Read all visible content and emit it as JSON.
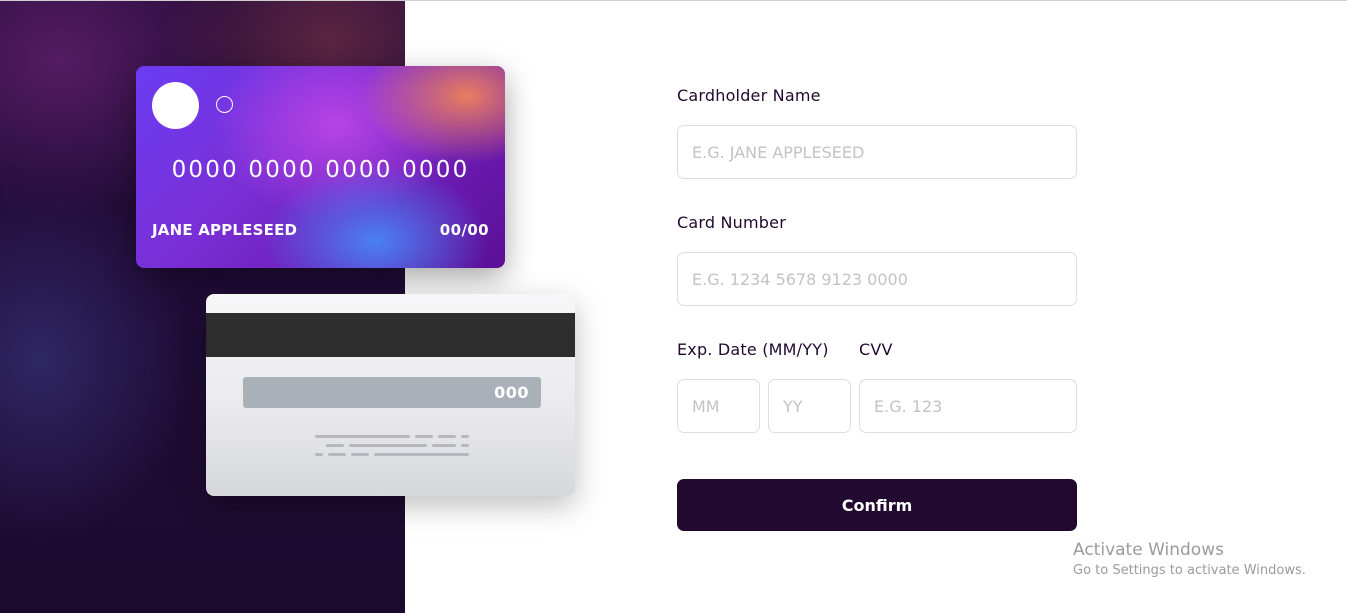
{
  "card_front": {
    "number": "0000 0000 0000 0000",
    "name": "JANE APPLESEED",
    "expiry": "00/00"
  },
  "card_back": {
    "cvv": "000"
  },
  "form": {
    "cardholder_label": "Cardholder Name",
    "cardholder_placeholder": "E.G. JANE APPLESEED",
    "number_label": "Card Number",
    "number_placeholder": "E.G. 1234 5678 9123 0000",
    "exp_label": "Exp. Date (MM/YY)",
    "month_placeholder": "MM",
    "year_placeholder": "YY",
    "cvv_label": "CVV",
    "cvv_placeholder": "E.G. 123",
    "confirm_label": "Confirm"
  },
  "watermark": {
    "title": "Activate Windows",
    "subtitle": "Go to Settings to activate Windows."
  },
  "colors": {
    "primary": "#21092f",
    "input_border": "#dedddf",
    "placeholder": "#c4c2c7"
  }
}
